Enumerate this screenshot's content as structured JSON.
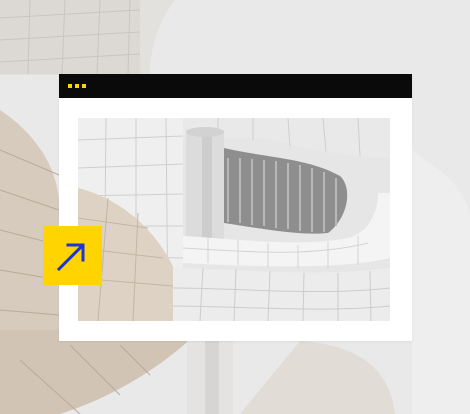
{
  "window": {
    "titlebar_dots": 3
  },
  "image": {
    "subject": "white-architecture-photo"
  },
  "colors": {
    "accent": "#ffd400",
    "titlebar": "#0a0a0a",
    "frame": "#ffffff",
    "arrow": "#1b35d6",
    "background": "#e9e9ea"
  },
  "icons": {
    "window_controls": "dots-icon",
    "external_link": "arrow-up-right-icon"
  }
}
